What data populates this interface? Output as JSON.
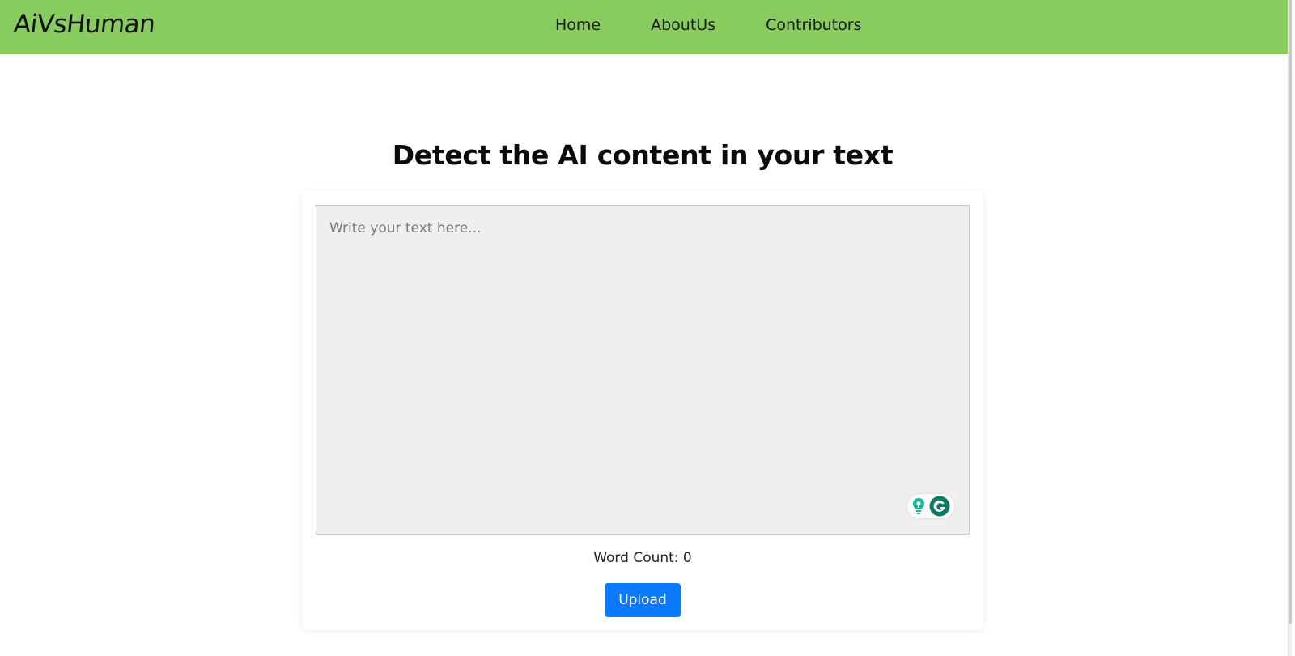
{
  "navbar": {
    "brand": "AiVsHuman",
    "links": [
      {
        "label": "Home"
      },
      {
        "label": "AboutUs"
      },
      {
        "label": "Contributors"
      }
    ],
    "background_color": "#88cc60"
  },
  "main": {
    "title": "Detect the AI content in your text",
    "text_input": {
      "placeholder": "Write your text here...",
      "value": ""
    },
    "word_count_label": "Word Count: 0",
    "upload_label": "Upload",
    "accent_color": "#0b7bfb"
  },
  "widgets": {
    "grammarly_icons": [
      "bulb-icon",
      "grammarly-icon"
    ]
  }
}
